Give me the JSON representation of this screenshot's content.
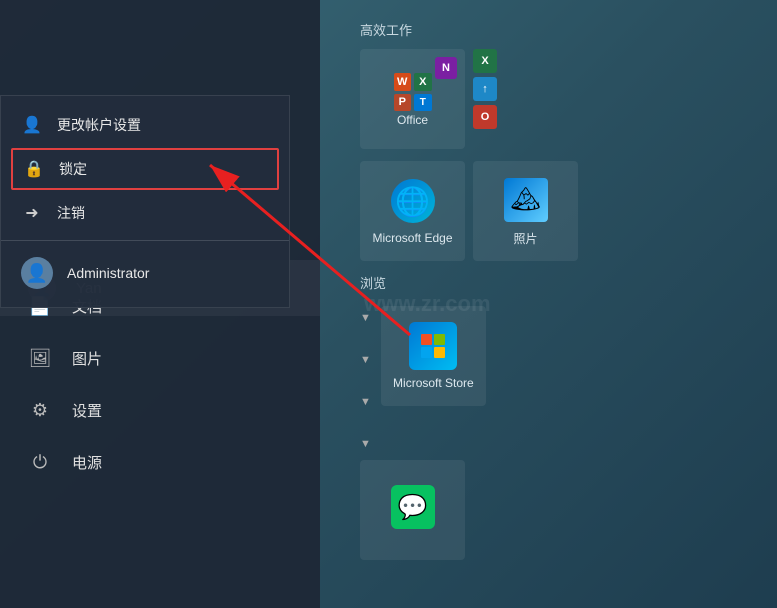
{
  "sidebar": {
    "yan_label": "Yan",
    "items": [
      {
        "id": "documents",
        "label": "文档",
        "icon": "📄"
      },
      {
        "id": "pictures",
        "label": "图片",
        "icon": "🖼"
      },
      {
        "id": "settings",
        "label": "设置",
        "icon": "⚙"
      },
      {
        "id": "power",
        "label": "电源",
        "icon": "⏻"
      }
    ]
  },
  "popup": {
    "account_settings": "更改帐户设置",
    "lock": "锁定",
    "logout": "注销",
    "administrator": "Administrator"
  },
  "apps": {
    "section1_label": "高效工作",
    "section2_label": "浏览",
    "office_label": "Office",
    "edge_label": "Microsoft Edge",
    "photos_label": "照片",
    "store_label": "Microsoft Store",
    "wechat_label": "微信"
  },
  "watermark": "www.zr.com"
}
